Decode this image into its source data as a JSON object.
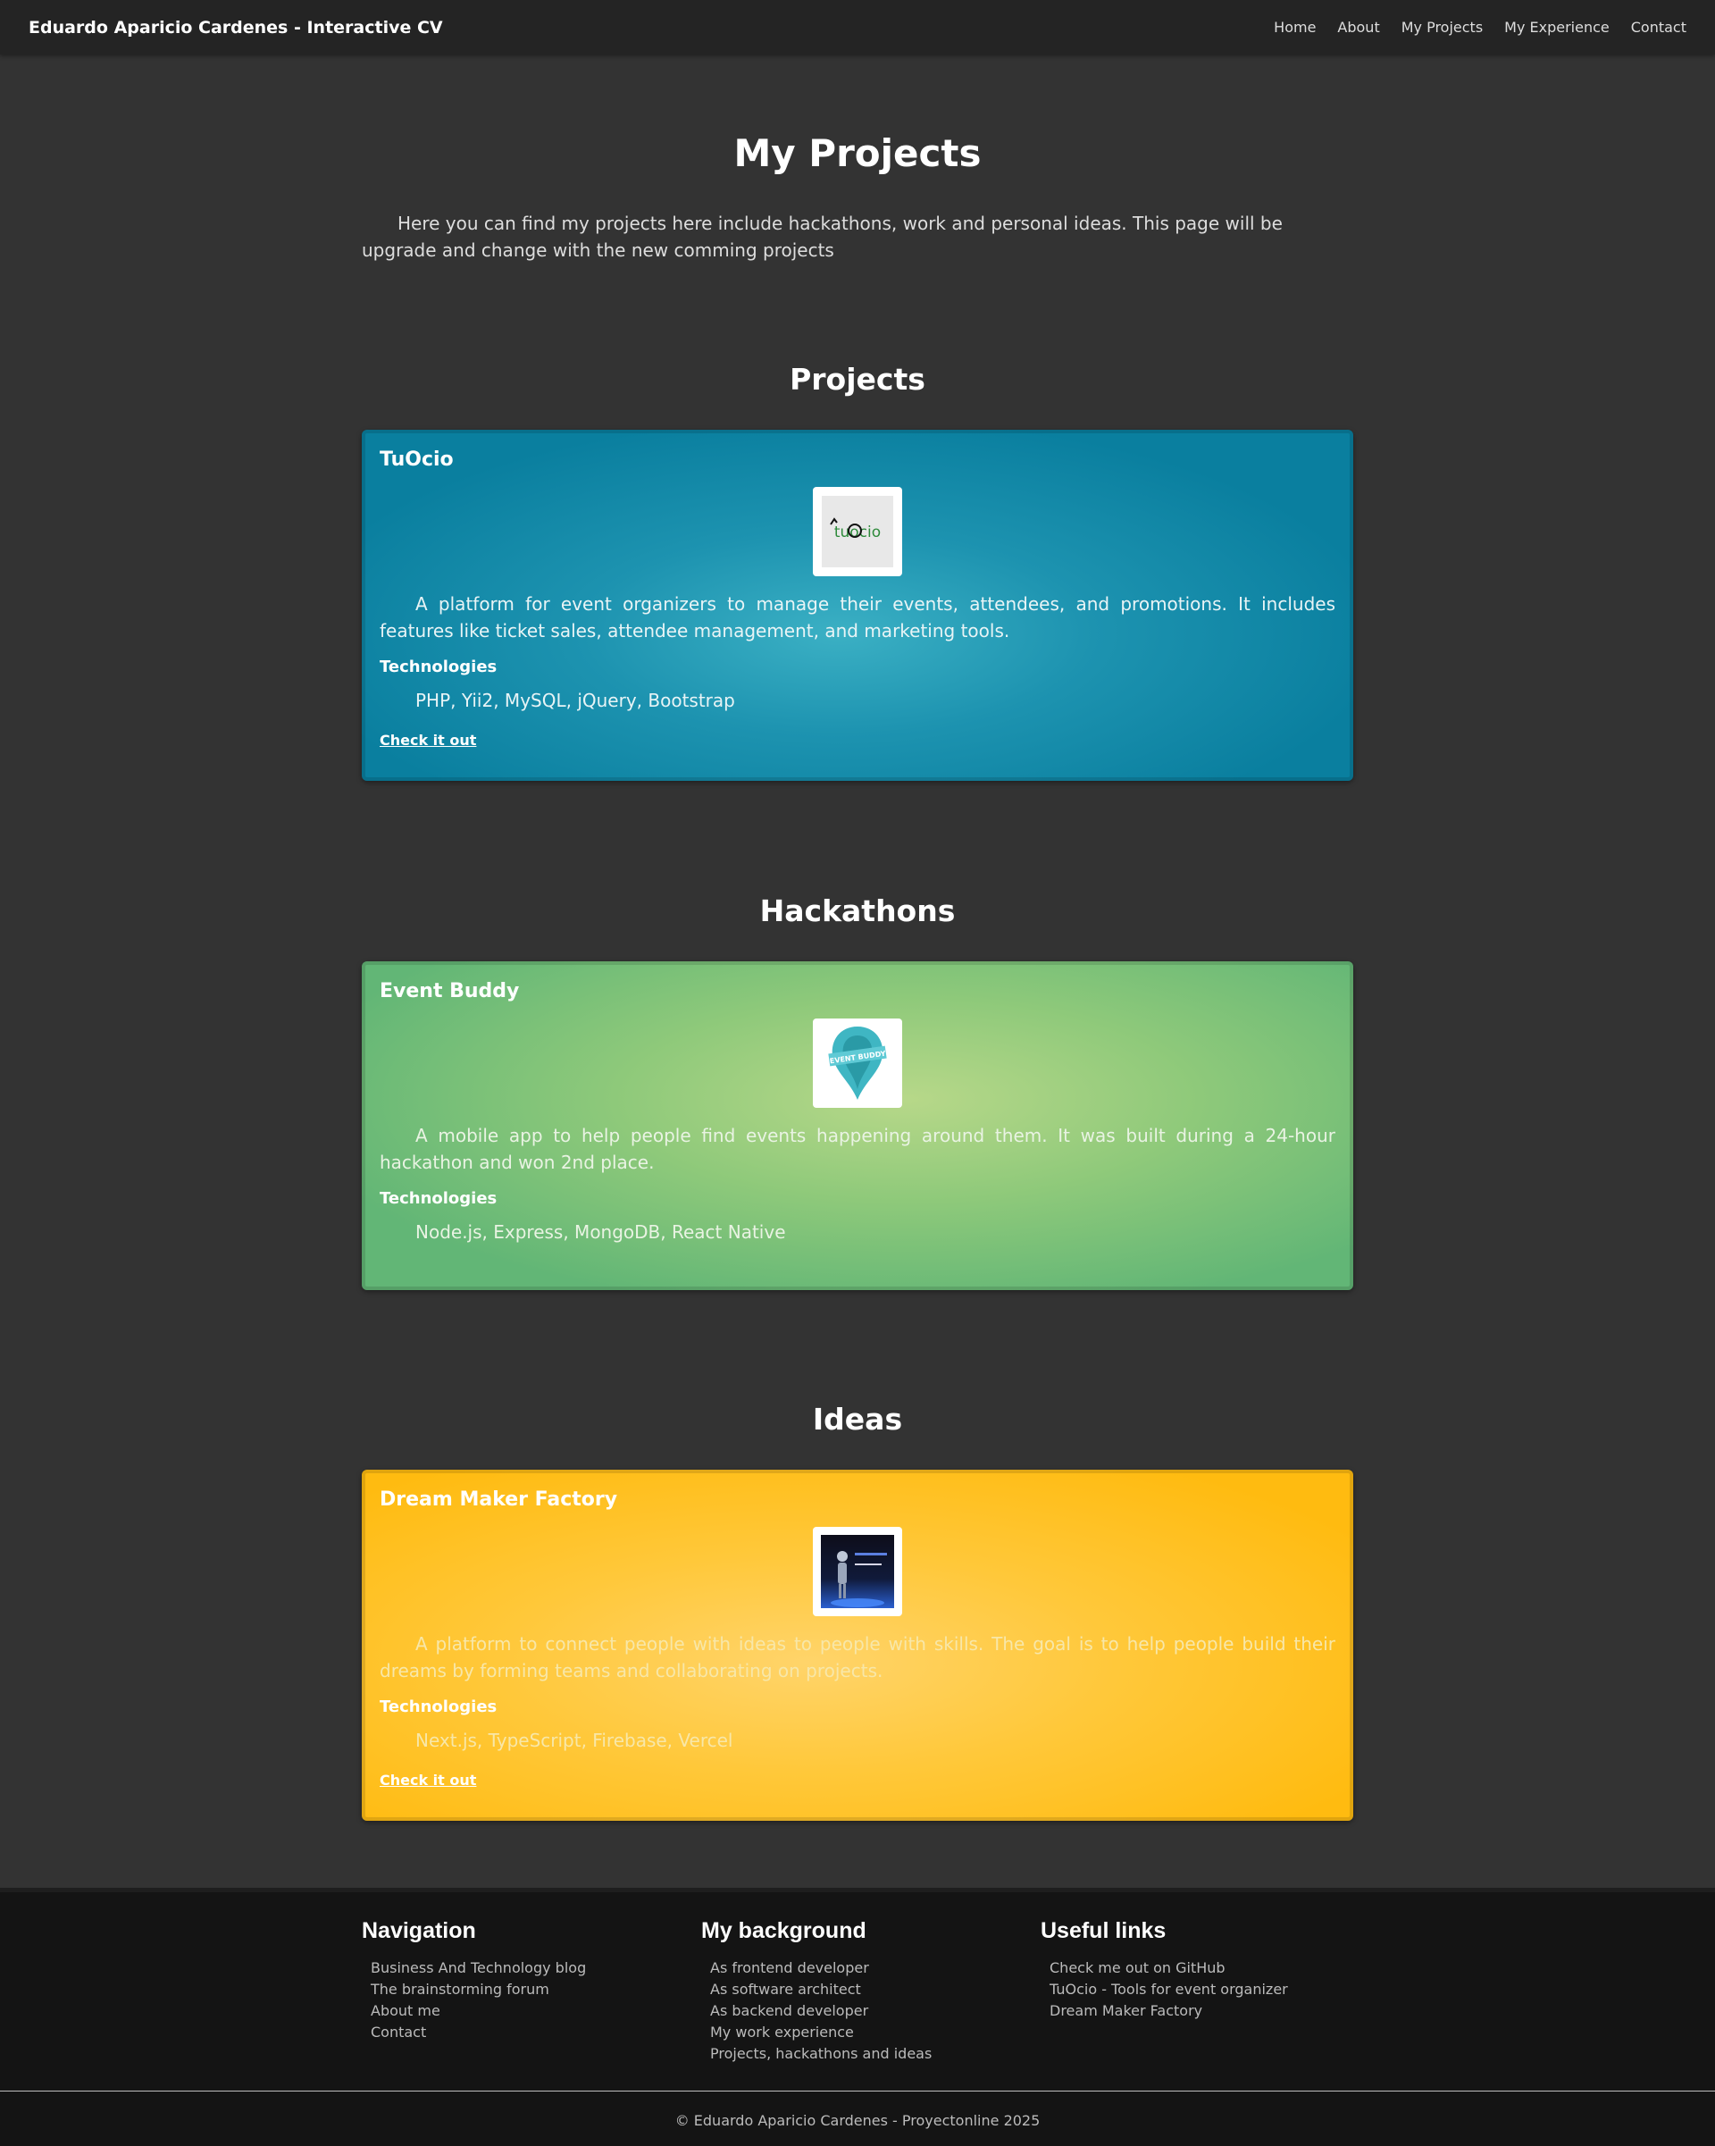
{
  "header": {
    "brand": "Eduardo Aparicio Cardenes - Interactive CV",
    "nav": [
      "Home",
      "About",
      "My Projects",
      "My Experience",
      "Contact"
    ]
  },
  "page": {
    "title": "My Projects",
    "intro": "Here you can find my projects here include hackathons, work and personal ideas. This page will be upgrade and change with the new comming projects"
  },
  "sections": [
    {
      "title": "Projects",
      "card": {
        "title": "TuOcio",
        "logo_icon": "tuocio-logo",
        "description": "A platform for event organizers to manage their events, attendees, and promotions. It includes features like ticket sales, attendee management, and marketing tools.",
        "tech_label": "Technologies",
        "technologies": "PHP, Yii2, MySQL, jQuery, Bootstrap",
        "link": "Check it out",
        "color": "#0a7f9f"
      }
    },
    {
      "title": "Hackathons",
      "card": {
        "title": "Event Buddy",
        "logo_icon": "event-buddy-logo",
        "logo_text": "EVENT BUDDY",
        "description": "A mobile app to help people find events happening around them. It was built during a 24-hour hackathon and won 2nd place.",
        "tech_label": "Technologies",
        "technologies": "Node.js, Express, MongoDB, React Native",
        "color": "#62b676"
      }
    },
    {
      "title": "Ideas",
      "card": {
        "title": "Dream Maker Factory",
        "logo_icon": "dream-maker-factory-logo",
        "description": "A platform to connect people with ideas to people with skills. The goal is to help people build their dreams by forming teams and collaborating on projects.",
        "tech_label": "Technologies",
        "technologies": "Next.js, TypeScript, Firebase, Vercel",
        "link": "Check it out",
        "color": "#ffbb10"
      }
    }
  ],
  "footer": {
    "columns": [
      {
        "title": "Navigation",
        "links": [
          "Business And Technology blog",
          "The brainstorming forum",
          "About me",
          "Contact"
        ]
      },
      {
        "title": "My background",
        "links": [
          "As frontend developer",
          "As software architect",
          "As backend developer",
          "My work experience",
          "Projects, hackathons and ideas"
        ]
      },
      {
        "title": "Useful links",
        "links": [
          "Check me out on GitHub",
          "TuOcio - Tools for event organizer",
          "Dream Maker Factory"
        ]
      }
    ],
    "copyright": "© Eduardo Aparicio Cardenes - Proyectonline 2025"
  }
}
